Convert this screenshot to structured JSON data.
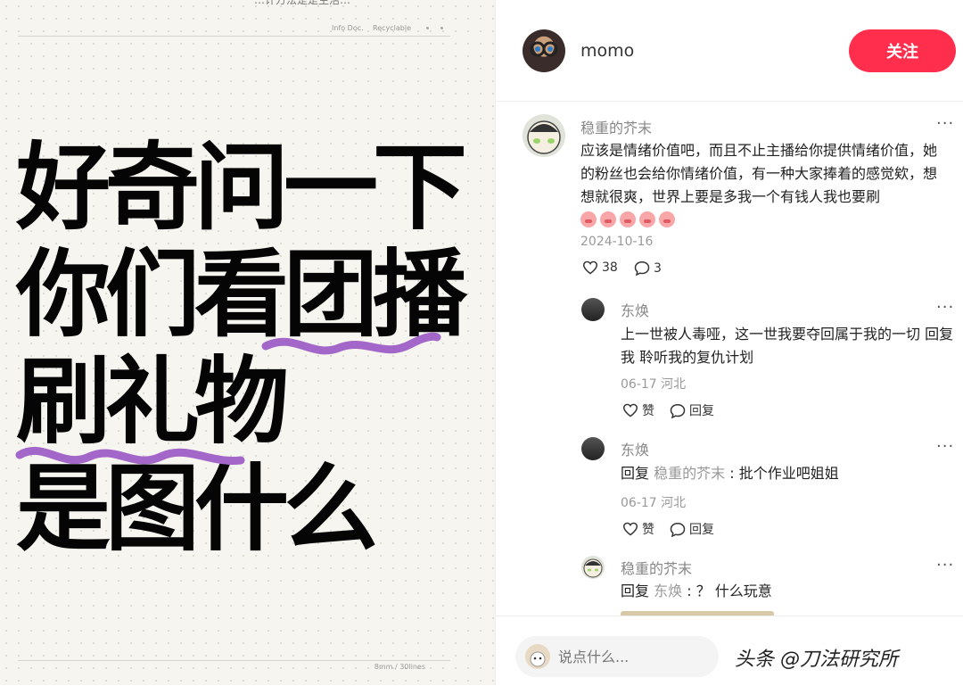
{
  "note": {
    "top_partial_text": "…计方法是是生活…",
    "meta_info": "Info Doc.",
    "meta_recycle": "Recyclable",
    "line1": "好奇问一下",
    "line2": "你们看团播",
    "line3": "刷礼物",
    "line4": "是图什么",
    "footer": "8mm / 30lines"
  },
  "header": {
    "username": "momo",
    "follow_label": "关注"
  },
  "comments": [
    {
      "author": "稳重的芥末",
      "text": "应该是情绪价值吧，而且不止主播给你提供情绪价值，她的粉丝也会给你情绪价值，有一种大家捧着的感觉欸，想想就很爽，世界上要是多我一个有钱人我也要刷",
      "date": "2024-10-16",
      "likes": "38",
      "replies": "3",
      "more": "···"
    }
  ],
  "replies": [
    {
      "author": "东焕",
      "text": "上一世被人毒哑，这一世我要夺回属于我的一切 回复我 聆听我的复仇计划",
      "meta": "06-17 河北",
      "like_label": "赞",
      "reply_label": "回复",
      "more": "···"
    },
    {
      "author": "东焕",
      "reply_prefix": "回复",
      "reply_to": "稳重的芥末",
      "text": ": 批个作业吧姐姐",
      "meta": "06-17 河北",
      "like_label": "赞",
      "reply_label": "回复",
      "more": "···"
    },
    {
      "author": "稳重的芥末",
      "reply_prefix": "回复",
      "reply_to": "东焕",
      "text": ": ？ 什么玩意",
      "more": "···"
    }
  ],
  "composer": {
    "placeholder": "说点什么..."
  },
  "watermark": "头条 @刀法研究所",
  "colors": {
    "accent": "#ff2e4d",
    "squiggle": "#a366c9"
  }
}
